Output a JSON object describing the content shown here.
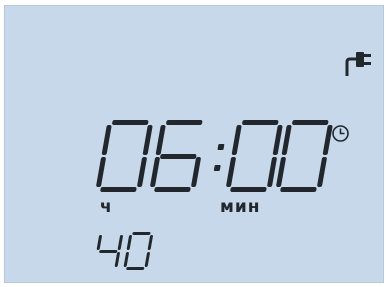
{
  "display": {
    "main_time": "06:00",
    "hours_unit_label": "ч",
    "minutes_unit_label": "мин",
    "secondary_value": "40"
  },
  "icons": {
    "power": "power-plug-icon",
    "clock": "clock-icon"
  },
  "colors": {
    "lcd_background": "#c6d8ea",
    "segment": "#22272e"
  }
}
